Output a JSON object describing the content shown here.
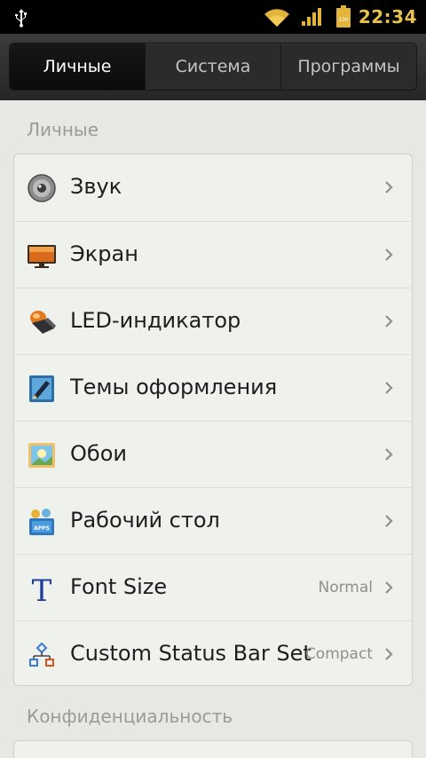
{
  "status_bar": {
    "time": "22:34",
    "battery_level": "100",
    "icons": [
      "usb-icon",
      "wifi-icon",
      "signal-icon",
      "battery-icon"
    ]
  },
  "tabs": [
    {
      "label": "Личные",
      "active": true
    },
    {
      "label": "Система",
      "active": false
    },
    {
      "label": "Программы",
      "active": false
    }
  ],
  "sections": [
    {
      "header": "Личные",
      "items": [
        {
          "label": "Звук",
          "value": "",
          "icon": "speaker-icon"
        },
        {
          "label": "Экран",
          "value": "",
          "icon": "monitor-icon"
        },
        {
          "label": "LED-индикатор",
          "value": "",
          "icon": "led-lamp-icon"
        },
        {
          "label": "Темы оформления",
          "value": "",
          "icon": "themes-icon"
        },
        {
          "label": "Обои",
          "value": "",
          "icon": "wallpaper-icon"
        },
        {
          "label": "Рабочий стол",
          "value": "",
          "icon": "desktop-icon"
        },
        {
          "label": "Font Size",
          "value": "Normal",
          "icon": "font-size-icon"
        },
        {
          "label": "Custom Status Bar Settings",
          "value": "Compact",
          "icon": "status-bar-icon"
        }
      ]
    },
    {
      "header": "Конфиденциальность",
      "items": []
    }
  ],
  "colors": {
    "clock": "#e6c14d",
    "background": "#e6e8e4",
    "card": "#eef1ec",
    "tab_active": "#0b0b0b"
  }
}
